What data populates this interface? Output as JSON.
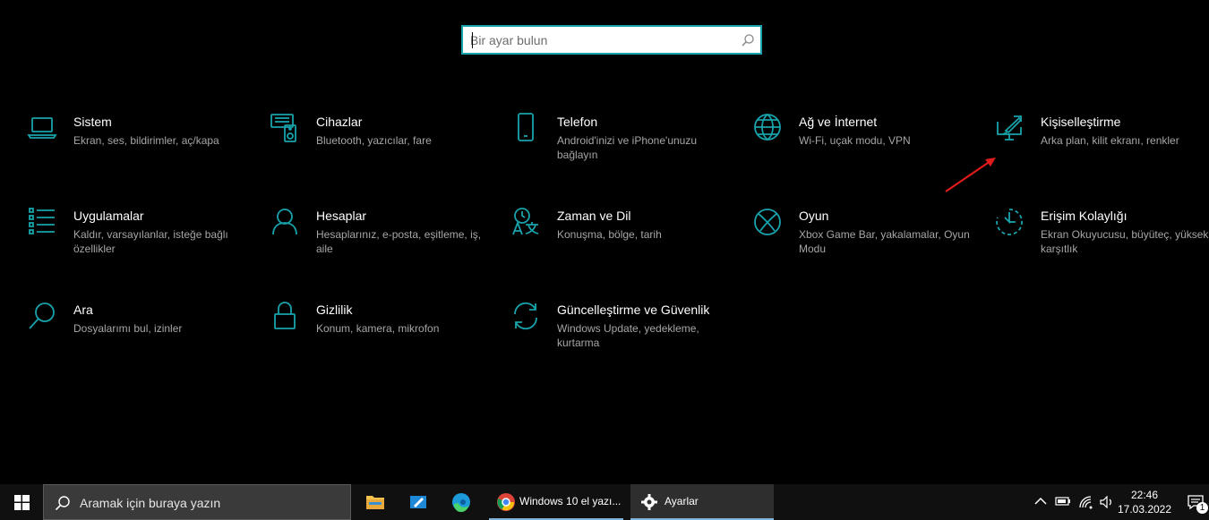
{
  "search": {
    "placeholder": "Bir ayar bulun"
  },
  "categories": [
    {
      "icon": "laptop-icon",
      "title": "Sistem",
      "subtitle": "Ekran, ses, bildirimler, aç/kapa"
    },
    {
      "icon": "keyboard-speaker-icon",
      "title": "Cihazlar",
      "subtitle": "Bluetooth, yazıcılar, fare"
    },
    {
      "icon": "phone-icon",
      "title": "Telefon",
      "subtitle": "Android'inizi ve iPhone'unuzu bağlayın"
    },
    {
      "icon": "globe-icon",
      "title": "Ağ ve İnternet",
      "subtitle": "Wi-Fi, uçak modu, VPN"
    },
    {
      "icon": "paint-screen-icon",
      "title": "Kişiselleştirme",
      "subtitle": "Arka plan, kilit ekranı, renkler"
    },
    {
      "icon": "apps-list-icon",
      "title": "Uygulamalar",
      "subtitle": "Kaldır, varsayılanlar, isteğe bağlı özellikler"
    },
    {
      "icon": "person-icon",
      "title": "Hesaplar",
      "subtitle": "Hesaplarınız, e-posta, eşitleme, iş, aile"
    },
    {
      "icon": "time-language-icon",
      "title": "Zaman ve Dil",
      "subtitle": "Konuşma, bölge, tarih"
    },
    {
      "icon": "xbox-icon",
      "title": "Oyun",
      "subtitle": "Xbox Game Bar, yakalamalar, Oyun Modu"
    },
    {
      "icon": "accessibility-timer-icon",
      "title": "Erişim Kolaylığı",
      "subtitle": "Ekran Okuyucusu, büyüteç, yüksek karşıtlık"
    },
    {
      "icon": "magnifier-icon",
      "title": "Ara",
      "subtitle": "Dosyalarımı bul, izinler"
    },
    {
      "icon": "lock-icon",
      "title": "Gizlilik",
      "subtitle": "Konum, kamera, mikrofon"
    },
    {
      "icon": "sync-icon",
      "title": "Güncelleştirme ve Güvenlik",
      "subtitle": "Windows Update, yedekleme, kurtarma"
    }
  ],
  "taskbar": {
    "search_text": "Aramak için buraya yazın",
    "apps": [
      {
        "icon": "file-explorer-icon"
      },
      {
        "icon": "pen-app-icon"
      },
      {
        "icon": "edge-icon"
      },
      {
        "icon": "chrome-icon",
        "label": "Windows 10 el yazı..."
      },
      {
        "icon": "gear-icon",
        "label": "Ayarlar"
      }
    ],
    "time": "22:46",
    "date": "17.03.2022",
    "notification_count": "1"
  },
  "colors": {
    "accent": "#18a3ac",
    "annotation": "#e01b1b",
    "background": "#000000"
  }
}
